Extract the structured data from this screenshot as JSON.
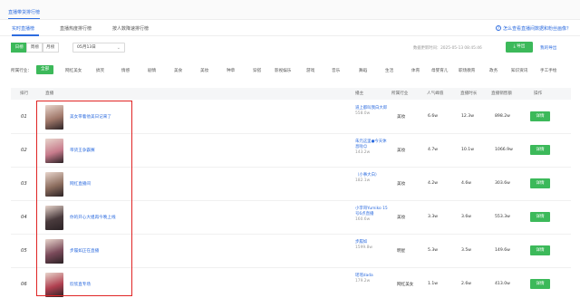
{
  "top_tab": "直播带货排行榜",
  "sub_tabs": [
    "实时直播榜",
    "直播热度排行榜",
    "按人数降速排行榜"
  ],
  "help_text": "怎么查看直播间数据和粉丝画像？",
  "period_buttons": [
    "日榜",
    "周榜",
    "月榜"
  ],
  "date_value": "05月13日",
  "update_time": "数据更新时间：2025-05-13 08:45:46",
  "export_label": "导出",
  "my_export_label": "我的导出",
  "filter_label": "所属行业：",
  "filter_items": [
    "全部",
    "网红美女",
    "搞笑",
    "情感",
    "剧情",
    "美食",
    "美妆",
    "种草",
    "穿搭",
    "影视娱乐",
    "游戏",
    "音乐",
    "舞蹈",
    "生活",
    "体育",
    "母婴育儿",
    "职场教育",
    "政务",
    "知识资讯",
    "手工手绘"
  ],
  "columns": [
    "排行",
    "直播",
    "播主",
    "所属行业",
    "人气峰值",
    "直播时长",
    "直播销售额",
    "操作"
  ],
  "rows": [
    {
      "rank": "01",
      "title": "美女带着他美日记来了",
      "streamer": "道上都叫我白大郎",
      "fans": "558.0w",
      "industry": "美妆",
      "peak": "6.6w",
      "duration": "12.3w",
      "sales": "898.2w",
      "action": "详情",
      "thumb_color": "#a0786a"
    },
    {
      "rank": "02",
      "title": "带货王争霸赛",
      "streamer": "朱元这里●今天休息啦😊",
      "fans": "143.2w",
      "industry": "美妆",
      "peak": "4.7w",
      "duration": "10.1w",
      "sales": "1066.9w",
      "action": "详情",
      "thumb_color": "#c77b8c"
    },
    {
      "rank": "03",
      "title": "网红直播间",
      "streamer": "（小事大白）",
      "fans": "182.1w",
      "industry": "美妆",
      "peak": "4.2w",
      "duration": "4.6w",
      "sales": "303.6w",
      "action": "详情",
      "thumb_color": "#8d6e5f"
    },
    {
      "rank": "04",
      "title": "你的开心大姐再今晚上线",
      "streamer": "小李哥Yumiko 15号6点直播",
      "fans": "160.6w",
      "industry": "美妆",
      "peak": "3.3w",
      "duration": "3.6w",
      "sales": "553.3w",
      "action": "详情",
      "thumb_color": "#4a3b3d"
    },
    {
      "rank": "05",
      "title": "步履如正在直播",
      "streamer": "步履如",
      "fans": "1599.8w",
      "industry": "明星",
      "peak": "5.3w",
      "duration": "3.5w",
      "sales": "149.6w",
      "action": "详情",
      "thumb_color": "#7a4a5a"
    },
    {
      "rank": "06",
      "title": "欣欣直专场",
      "streamer": "瑶瑶dada",
      "fans": "179.2w",
      "industry": "网红美女",
      "peak": "1.1w",
      "duration": "2.6w",
      "sales": "413.0w",
      "action": "详情",
      "thumb_color": "#b04050"
    }
  ],
  "colors": {
    "accent_green": "#3cb95a",
    "link_blue": "#2d6cdf",
    "highlight_red": "#e02424"
  }
}
